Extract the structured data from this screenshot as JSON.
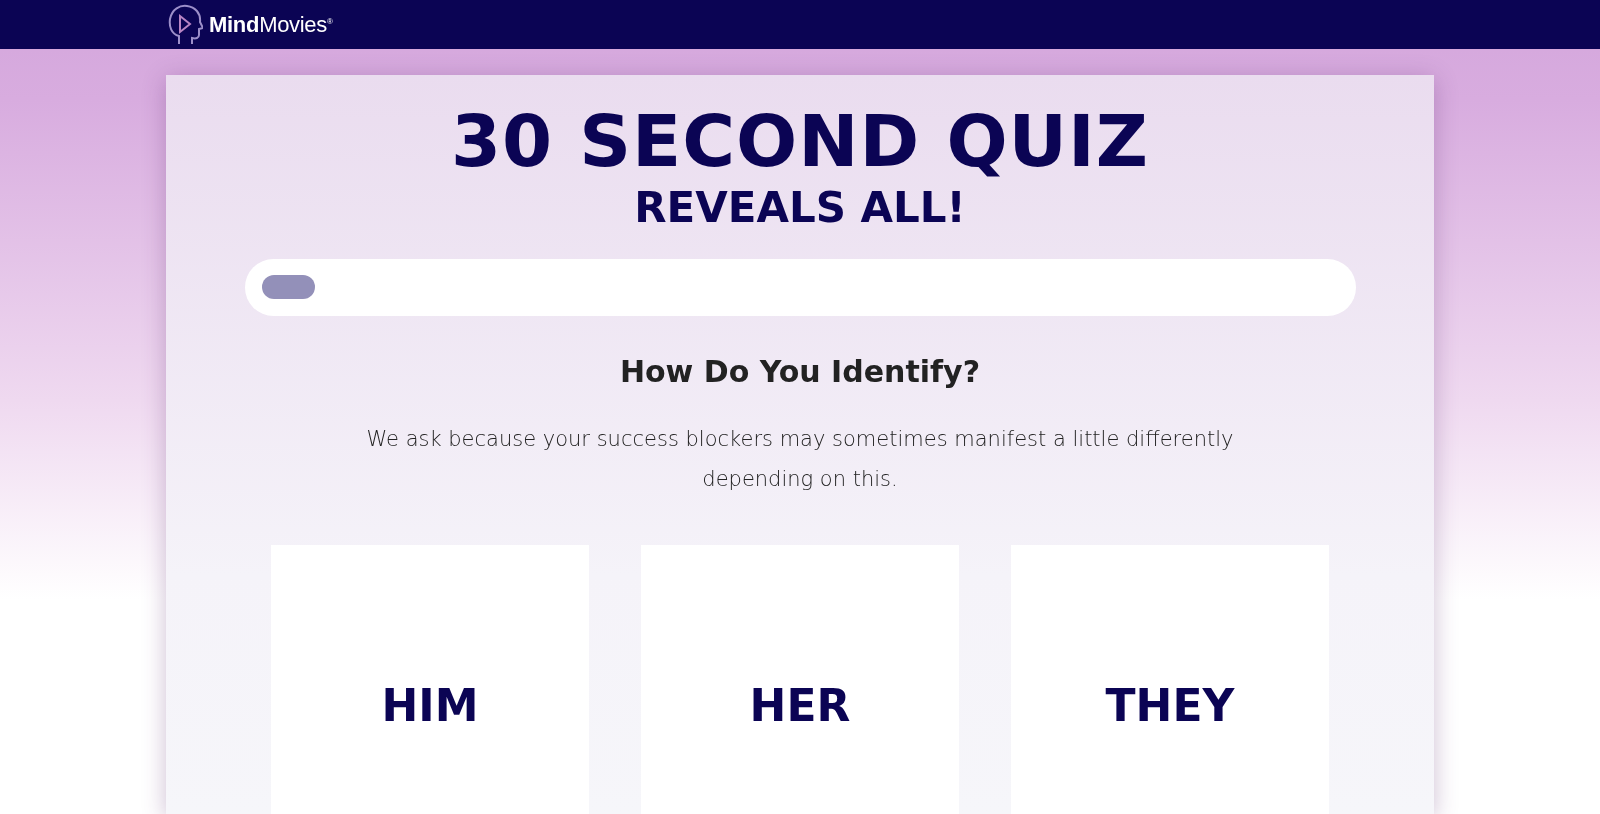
{
  "header": {
    "logo": "**Mind**Movies$^{®}$"
  },
  "quiz": {
    "title": "30 SECOND QUIZ",
    "subtitle": "REVEALS ALL!",
    "progress": {
      "level": 0.05
    },
    "question": "How Do You Identify?",
    "description": "We ask because your success blockers may sometimes manifest a little differently depending on this.",
    "options": [
      {
        "label": "HIM"
      },
      {
        "label": "HER"
      },
      {
        "label": "THEY"
      }
    ]
  }
}
